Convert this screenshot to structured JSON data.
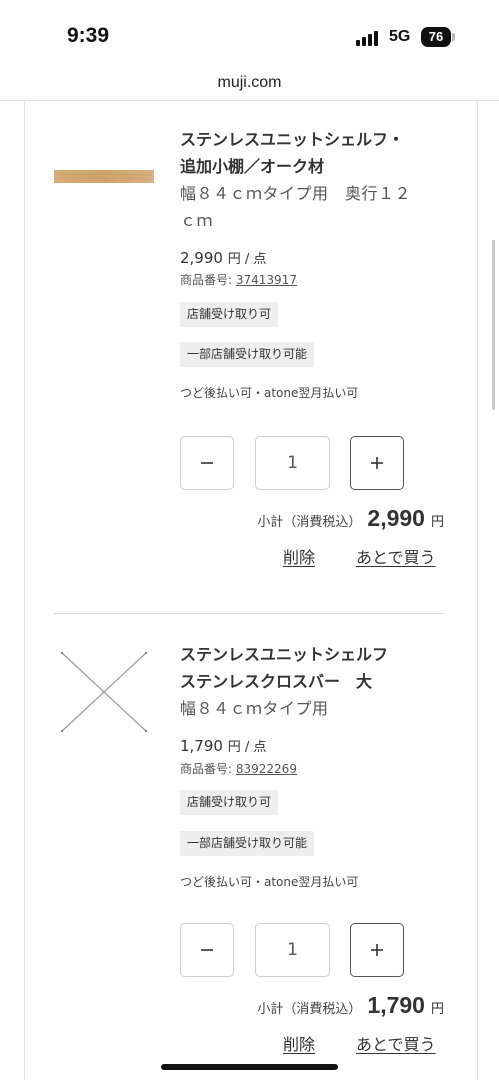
{
  "status_bar": {
    "time": "9:39",
    "network": "5G",
    "battery": "76"
  },
  "browser": {
    "url": "muji.com"
  },
  "items": [
    {
      "name_line1": "ステンレスユニットシェルフ・",
      "name_line2": "追加小棚／オーク材",
      "variant_line1": "幅８４ｃｍタイプ用　奥行１２",
      "variant_line2": "ｃｍ",
      "price": "2,990",
      "price_unit": "円 / 点",
      "sku_label": "商品番号:",
      "sku": "37413917",
      "badge_store": "店舗受け取り可",
      "badge_partial": "一部店舗受け取り可能",
      "payment_note": "つど後払い可・atone翌月払い可",
      "quantity": "1",
      "subtotal_label": "小計（消費税込）",
      "subtotal": "2,990",
      "currency": "円",
      "delete_label": "削除",
      "save_later_label": "あとで買う",
      "thumbnail_icon": "oak-shelf-board-image"
    },
    {
      "name_line1": "ステンレスユニットシェルフ",
      "name_line2": "ステンレスクロスバー　大",
      "variant_line1": "幅８４ｃｍタイプ用",
      "variant_line2": "",
      "price": "1,790",
      "price_unit": "円 / 点",
      "sku_label": "商品番号:",
      "sku": "83922269",
      "badge_store": "店舗受け取り可",
      "badge_partial": "一部店舗受け取り可能",
      "payment_note": "つど後払い可・atone翌月払い可",
      "quantity": "1",
      "subtotal_label": "小計（消費税込）",
      "subtotal": "1,790",
      "currency": "円",
      "delete_label": "削除",
      "save_later_label": "あとで買う",
      "thumbnail_icon": "cross-bar-image"
    }
  ],
  "icons": {
    "minus": "minus-icon",
    "plus": "plus-icon",
    "signal": "cellular-signal-icon",
    "battery": "battery-icon"
  },
  "colors": {
    "badge_bg": "#eeeeee",
    "text": "#333333",
    "divider": "#dcdcdc"
  }
}
